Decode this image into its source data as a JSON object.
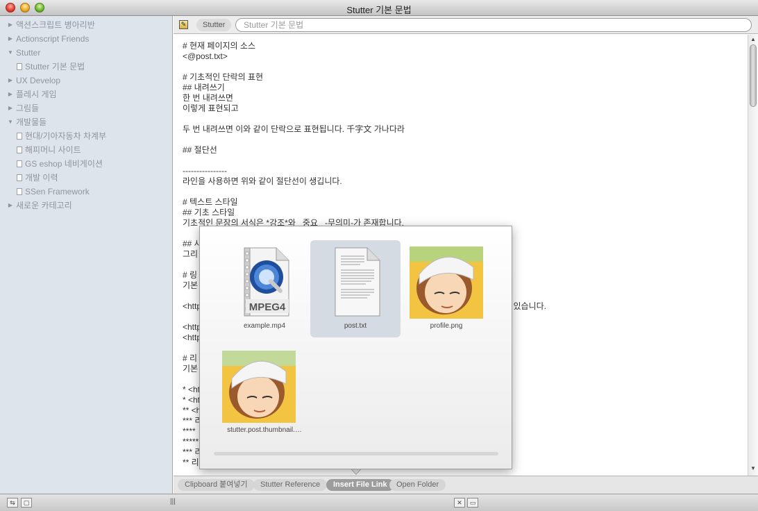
{
  "window": {
    "title": "Stutter 기본 문법"
  },
  "sidebar": {
    "items": [
      {
        "label": "액션스크립트 병아리반",
        "level": 0,
        "expanded": false
      },
      {
        "label": "Actionscript Friends",
        "level": 0,
        "expanded": false
      },
      {
        "label": "Stutter",
        "level": 0,
        "expanded": true
      },
      {
        "label": "Stutter 기본 문법",
        "level": 1
      },
      {
        "label": "UX Develop",
        "level": 0,
        "expanded": false
      },
      {
        "label": "플레시 게임",
        "level": 0,
        "expanded": false
      },
      {
        "label": "그림들",
        "level": 0,
        "expanded": false
      },
      {
        "label": "개발물들",
        "level": 0,
        "expanded": true
      },
      {
        "label": "현대/기아자동차 차계부",
        "level": 1
      },
      {
        "label": "해피머니 사이트",
        "level": 1
      },
      {
        "label": "GS eshop 네비게이션",
        "level": 1
      },
      {
        "label": "개발 이력",
        "level": 1
      },
      {
        "label": "SSen Framework",
        "level": 1
      },
      {
        "label": "새로운 카테고리",
        "level": 0,
        "expanded": false
      }
    ]
  },
  "pathbar": {
    "crumb": "Stutter",
    "field_value": "Stutter 기본 문법"
  },
  "editor": {
    "lines": [
      "# 현재 페이지의 소스",
      "<@post.txt>",
      "",
      "# 기초적인 단락의 표현",
      "## 내려쓰기",
      "한 번 내려쓰면",
      "이렇게 표현되고",
      "",
      "두 번 내려쓰면 이와 같이 단락으로 표현됩니다. 千字文 가나다라",
      "",
      "## 절단선",
      "",
      "----------------",
      "라인을 사용하면 위와 같이 절단선이 생깁니다.",
      "",
      "# 텍스트 스타일",
      "## 기초 스타일",
      "기초적인 문장의 서식은 *강조*와 _중요_ -무의미-가 존재합니다.",
      "",
      "## 사",
      "그리",
      "",
      "# 링",
      "기본",
      "",
      "<http                                                                                                     간히 적어서 사용할 수 있습니다.",
      "",
      "<http                                                                                                     . 적을 수 있고,",
      "<http",
      "",
      "# 리",
      "기본",
      "",
      "* <ht",
      "* <ht",
      "** <h",
      "*** 리",
      "****",
      "*****",
      "*** 리",
      "** 리"
    ]
  },
  "popover": {
    "files": [
      {
        "name": "example.mp4",
        "kind": "mpeg4-file-icon",
        "badge": "MPEG4"
      },
      {
        "name": "post.txt",
        "kind": "text-file-icon",
        "selected": true
      },
      {
        "name": "profile.png",
        "kind": "image-thumbnail"
      },
      {
        "name": "stutter.post.thumbnail.…",
        "kind": "image-thumbnail"
      }
    ]
  },
  "tabs": [
    {
      "label": "Clipboard 붙여넣기",
      "active": false
    },
    {
      "label": "Stutter Reference",
      "active": false
    },
    {
      "label": "Insert File Link",
      "active": true
    },
    {
      "label": "Open Folder",
      "active": false
    }
  ],
  "colors": {
    "sidebar_bg": "#dde4ec",
    "active_tab": "#9d9d9d",
    "selection": "#d5dbe2"
  }
}
